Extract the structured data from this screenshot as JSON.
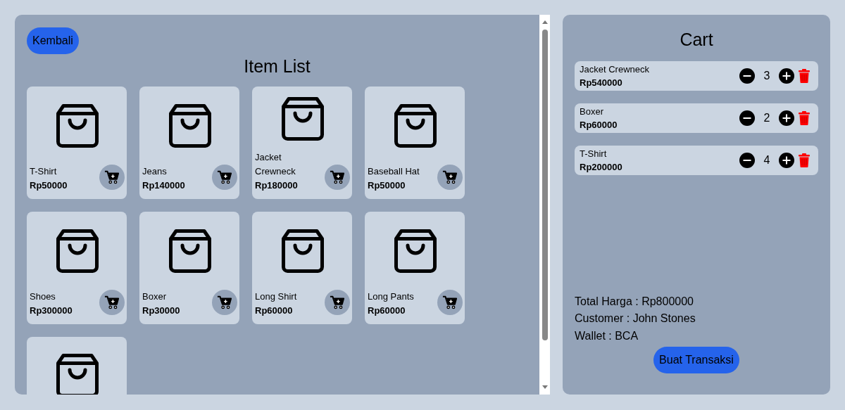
{
  "back_button": "Kembali",
  "item_list": {
    "title": "Item List",
    "items": [
      {
        "kind": "product",
        "name": "T-Shirt",
        "price": "Rp50000"
      },
      {
        "kind": "product",
        "name": "Jeans",
        "price": "Rp140000"
      },
      {
        "kind": "product",
        "name": "Jacket Crewneck",
        "price": "Rp180000"
      },
      {
        "kind": "product",
        "name": "Baseball Hat",
        "price": "Rp50000"
      },
      {
        "kind": "product",
        "name": "Shoes",
        "price": "Rp300000"
      },
      {
        "kind": "product",
        "name": "Boxer",
        "price": "Rp30000"
      },
      {
        "kind": "product",
        "name": "Long Shirt",
        "price": "Rp60000"
      },
      {
        "kind": "product",
        "name": "Long Pants",
        "price": "Rp60000"
      },
      {
        "kind": "cut_off"
      }
    ]
  },
  "cart": {
    "title": "Cart",
    "items": [
      {
        "name": "Jacket Crewneck",
        "price": "Rp540000",
        "quantity": "3"
      },
      {
        "name": "Boxer",
        "price": "Rp60000",
        "quantity": "2"
      },
      {
        "name": "T-Shirt",
        "price": "Rp200000",
        "quantity": "4"
      }
    ],
    "total": "Total Harga : Rp800000",
    "customer": "Customer : John Stones",
    "wallet": "Wallet : BCA",
    "submit_button": "Buat Transaksi"
  }
}
